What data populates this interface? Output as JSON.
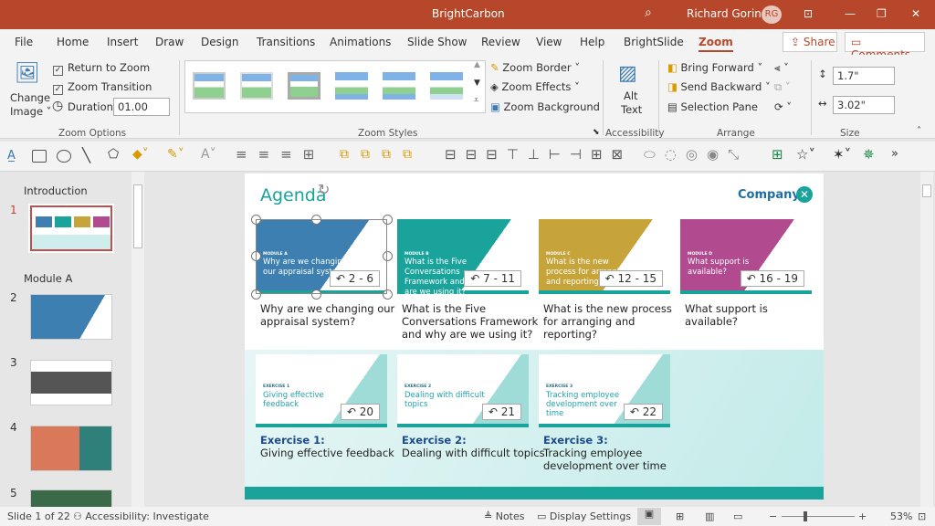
{
  "app": {
    "title": "BrightCarbon",
    "user": "Richard Goring",
    "initials": "RG"
  },
  "tabs": [
    "File",
    "Home",
    "Insert",
    "Draw",
    "Design",
    "Transitions",
    "Animations",
    "Slide Show",
    "Review",
    "View",
    "Help",
    "BrightSlide",
    "Zoom"
  ],
  "active_tab": "Zoom",
  "share": "Share",
  "comments": "Comments",
  "ribbon": {
    "change_image": [
      "Change",
      "Image"
    ],
    "return_to_zoom": "Return to Zoom",
    "zoom_transition": "Zoom Transition",
    "duration_label": "Duration:",
    "duration": "01.00",
    "zoom_options": "Zoom Options",
    "zoom_styles": "Zoom Styles",
    "zoom_border": "Zoom Border",
    "zoom_effects": "Zoom Effects",
    "zoom_background": "Zoom Background",
    "alt_text": [
      "Alt",
      "Text"
    ],
    "accessibility": "Accessibility",
    "bring_forward": "Bring Forward",
    "send_backward": "Send Backward",
    "selection_pane": "Selection Pane",
    "arrange": "Arrange",
    "height": "1.7\"",
    "width": "3.02\"",
    "size": "Size"
  },
  "slides_panel": {
    "sections": [
      "Introduction",
      "Module A"
    ],
    "numbers": [
      "1",
      "2",
      "3",
      "4",
      "5"
    ]
  },
  "slide": {
    "title": "Agenda",
    "logo": "Company",
    "modules": [
      {
        "tag": "MODULE A",
        "text": "Why are we changing our appraisal system?",
        "range": "2 - 6",
        "caption": "Why are we changing our appraisal system?",
        "color": "#3d7fb0"
      },
      {
        "tag": "MODULE B",
        "text": "What is the Five Conversations Framework and why are we using it?",
        "range": "7 - 11",
        "caption": "What is the Five Conversations Framework and why are we using it?",
        "color": "#1aa39b"
      },
      {
        "tag": "MODULE C",
        "text": "What is the new process for arranging and reporting?",
        "range": "12 - 15",
        "caption": "What is the new process for arranging and reporting?",
        "color": "#c7a43a"
      },
      {
        "tag": "MODULE D",
        "text": "What support is available?",
        "range": "16 - 19",
        "caption": "What support is available?",
        "color": "#b14a8e"
      }
    ],
    "exercises": [
      {
        "tag": "EXERCISE 1",
        "text": "Giving effective feedback",
        "num": "20",
        "title": "Exercise 1:",
        "caption": "Giving effective feedback"
      },
      {
        "tag": "EXERCISE 2",
        "text": "Dealing with difficult topics",
        "num": "21",
        "title": "Exercise 2:",
        "caption": "Dealing with difficult topics"
      },
      {
        "tag": "EXERCISE 3",
        "text": "Tracking employee development over time",
        "num": "22",
        "title": "Exercise 3:",
        "caption": "Tracking employee development over time"
      }
    ]
  },
  "status": {
    "slide": "Slide 1 of 22",
    "accessibility": "Accessibility: Investigate",
    "notes": "Notes",
    "display": "Display Settings",
    "zoom": "53%"
  }
}
